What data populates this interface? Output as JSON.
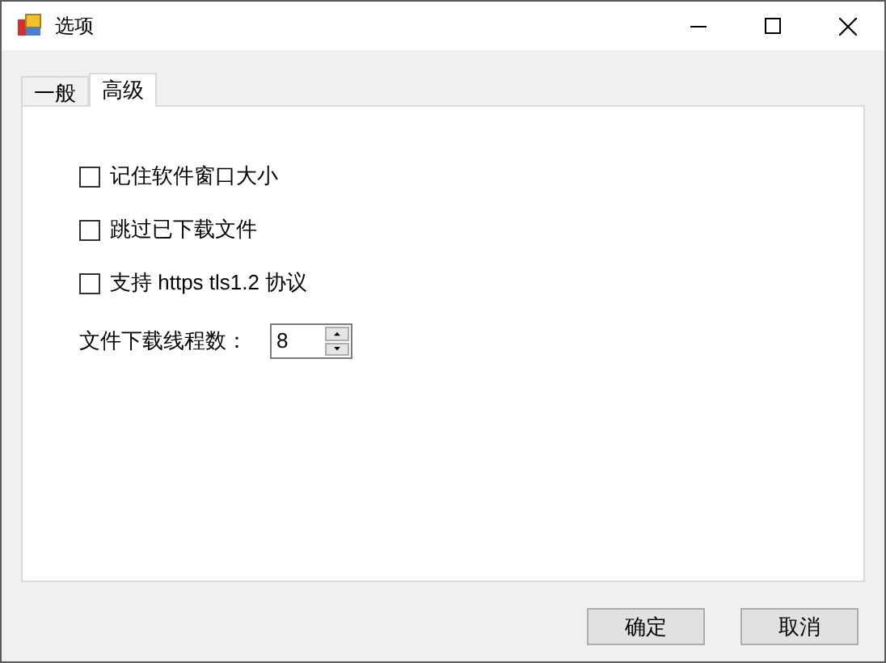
{
  "window": {
    "title": "选项"
  },
  "tabs": [
    {
      "label": "一般",
      "selected": false
    },
    {
      "label": "高级",
      "selected": true
    }
  ],
  "options": [
    {
      "label": "记住软件窗口大小",
      "checked": false
    },
    {
      "label": "跳过已下载文件",
      "checked": false
    },
    {
      "label": "支持 https tls1.2 协议",
      "checked": false
    }
  ],
  "thread_count": {
    "label": "文件下载线程数：",
    "value": "8"
  },
  "buttons": [
    "确定",
    "取消"
  ]
}
